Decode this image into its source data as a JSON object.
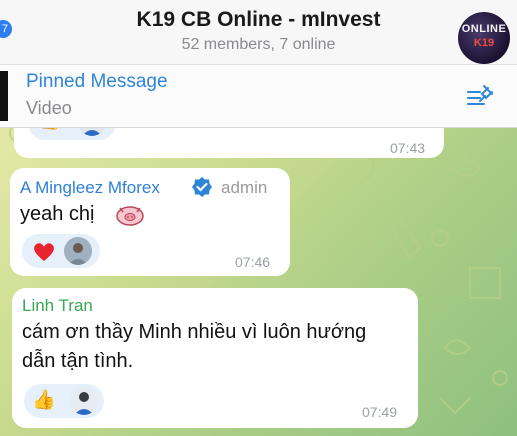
{
  "header": {
    "back_badge": "7",
    "title": "K19 CB Online - mInvest",
    "subtitle": "52 members, 7 online",
    "avatar_line1": "ONLINE",
    "avatar_line2": "K19"
  },
  "pinned": {
    "title": "Pinned Message",
    "subtitle": "Video"
  },
  "messages": [
    {
      "time": "07:43",
      "reactions": [
        "thumbs-up"
      ]
    },
    {
      "sender": "A Mingleez Mforex",
      "verified": true,
      "role": "admin",
      "text": "yeah chị",
      "sticker": "pig-emoji",
      "reactions": [
        "red-heart"
      ],
      "time": "07:46"
    },
    {
      "sender": "Linh Tran",
      "text_line1": "cám ơn thầy Minh nhiều vì luôn hướng",
      "text_line2": "dẫn tận tình.",
      "reactions": [
        "thumbs-up"
      ],
      "time": "07:49"
    }
  ],
  "colors": {
    "sender_admin": "#2f7fd4",
    "sender_linh": "#3aa757",
    "pinned_accent": "#2f86d6",
    "reaction_bg": "#e6f0fb",
    "heart": "#e8252f"
  }
}
